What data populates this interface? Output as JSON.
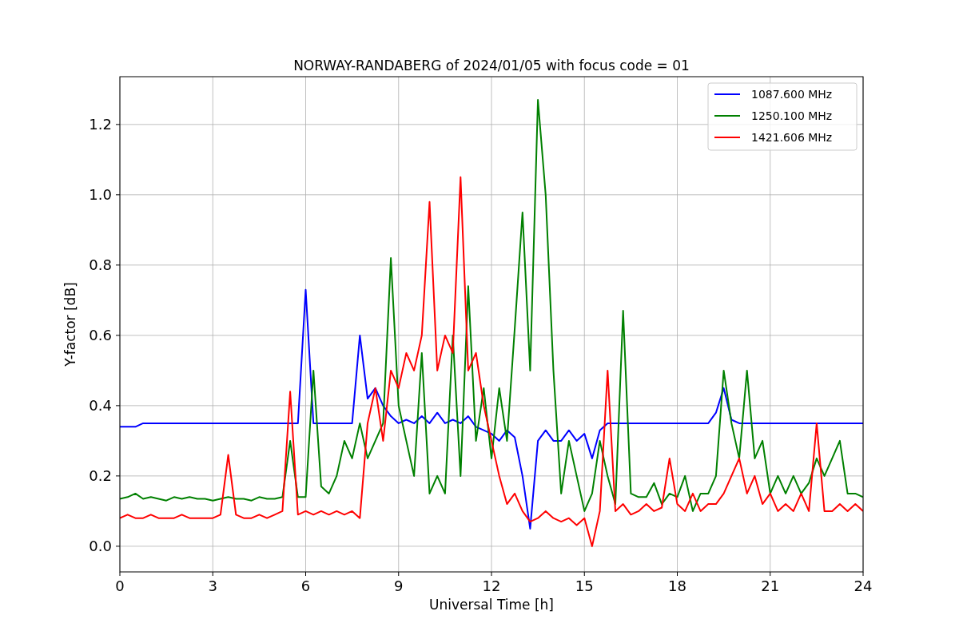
{
  "chart_data": {
    "type": "line",
    "title": "NORWAY-RANDABERG of 2024/01/05 with focus code = 01",
    "xlabel": "Universal Time [h]",
    "ylabel": "Y-factor [dB]",
    "x": [
      0,
      0.25,
      0.5,
      0.75,
      1,
      1.25,
      1.5,
      1.75,
      2,
      2.25,
      2.5,
      2.75,
      3,
      3.25,
      3.5,
      3.75,
      4,
      4.25,
      4.5,
      4.75,
      5,
      5.25,
      5.5,
      5.75,
      6,
      6.25,
      6.5,
      6.75,
      7,
      7.25,
      7.5,
      7.75,
      8,
      8.25,
      8.5,
      8.75,
      9,
      9.25,
      9.5,
      9.75,
      10,
      10.25,
      10.5,
      10.75,
      11,
      11.25,
      11.5,
      11.75,
      12,
      12.25,
      12.5,
      12.75,
      13,
      13.25,
      13.5,
      13.75,
      14,
      14.25,
      14.5,
      14.75,
      15,
      15.25,
      15.5,
      15.75,
      16,
      16.25,
      16.5,
      16.75,
      17,
      17.25,
      17.5,
      17.75,
      18,
      18.25,
      18.5,
      18.75,
      19,
      19.25,
      19.5,
      19.75,
      20,
      20.25,
      20.5,
      20.75,
      21,
      21.25,
      21.5,
      21.75,
      22,
      22.25,
      22.5,
      22.75,
      23,
      23.25,
      23.5,
      23.75,
      24
    ],
    "series": [
      {
        "name": "1087.600 MHz",
        "color": "#0000ff",
        "values": [
          0.34,
          0.34,
          0.34,
          0.35,
          0.35,
          0.35,
          0.35,
          0.35,
          0.35,
          0.35,
          0.35,
          0.35,
          0.35,
          0.35,
          0.35,
          0.35,
          0.35,
          0.35,
          0.35,
          0.35,
          0.35,
          0.35,
          0.35,
          0.35,
          0.73,
          0.35,
          0.35,
          0.35,
          0.35,
          0.35,
          0.35,
          0.6,
          0.42,
          0.45,
          0.4,
          0.37,
          0.35,
          0.36,
          0.35,
          0.37,
          0.35,
          0.38,
          0.35,
          0.36,
          0.35,
          0.37,
          0.34,
          0.33,
          0.32,
          0.3,
          0.33,
          0.31,
          0.2,
          0.05,
          0.3,
          0.33,
          0.3,
          0.3,
          0.33,
          0.3,
          0.32,
          0.25,
          0.33,
          0.35,
          0.35,
          0.35,
          0.35,
          0.35,
          0.35,
          0.35,
          0.35,
          0.35,
          0.35,
          0.35,
          0.35,
          0.35,
          0.35,
          0.38,
          0.45,
          0.36,
          0.35,
          0.35,
          0.35,
          0.35,
          0.35,
          0.35,
          0.35,
          0.35,
          0.35,
          0.35,
          0.35,
          0.35,
          0.35,
          0.35,
          0.35,
          0.35,
          0.35
        ]
      },
      {
        "name": "1250.100 MHz",
        "color": "#008000",
        "values": [
          0.135,
          0.14,
          0.15,
          0.135,
          0.14,
          0.135,
          0.13,
          0.14,
          0.135,
          0.14,
          0.135,
          0.135,
          0.13,
          0.135,
          0.14,
          0.135,
          0.135,
          0.13,
          0.14,
          0.135,
          0.135,
          0.14,
          0.3,
          0.14,
          0.14,
          0.5,
          0.17,
          0.15,
          0.2,
          0.3,
          0.25,
          0.35,
          0.25,
          0.3,
          0.35,
          0.82,
          0.4,
          0.3,
          0.2,
          0.55,
          0.15,
          0.2,
          0.15,
          0.6,
          0.2,
          0.74,
          0.3,
          0.45,
          0.25,
          0.45,
          0.3,
          0.62,
          0.95,
          0.5,
          1.27,
          1.0,
          0.5,
          0.15,
          0.3,
          0.2,
          0.1,
          0.15,
          0.3,
          0.2,
          0.12,
          0.67,
          0.15,
          0.14,
          0.14,
          0.18,
          0.12,
          0.15,
          0.14,
          0.2,
          0.1,
          0.15,
          0.15,
          0.2,
          0.5,
          0.35,
          0.25,
          0.5,
          0.25,
          0.3,
          0.15,
          0.2,
          0.15,
          0.2,
          0.15,
          0.18,
          0.25,
          0.2,
          0.25,
          0.3,
          0.15,
          0.15,
          0.14
        ]
      },
      {
        "name": "1421.606 MHz",
        "color": "#ff0000",
        "values": [
          0.08,
          0.09,
          0.08,
          0.08,
          0.09,
          0.08,
          0.08,
          0.08,
          0.09,
          0.08,
          0.08,
          0.08,
          0.08,
          0.09,
          0.26,
          0.09,
          0.08,
          0.08,
          0.09,
          0.08,
          0.09,
          0.1,
          0.44,
          0.09,
          0.1,
          0.09,
          0.1,
          0.09,
          0.1,
          0.09,
          0.1,
          0.08,
          0.35,
          0.45,
          0.3,
          0.5,
          0.45,
          0.55,
          0.5,
          0.6,
          0.98,
          0.5,
          0.6,
          0.55,
          1.05,
          0.5,
          0.55,
          0.4,
          0.3,
          0.2,
          0.12,
          0.15,
          0.1,
          0.07,
          0.08,
          0.1,
          0.08,
          0.07,
          0.08,
          0.06,
          0.08,
          0.0,
          0.1,
          0.5,
          0.1,
          0.12,
          0.09,
          0.1,
          0.12,
          0.1,
          0.11,
          0.25,
          0.12,
          0.1,
          0.15,
          0.1,
          0.12,
          0.12,
          0.15,
          0.2,
          0.25,
          0.15,
          0.2,
          0.12,
          0.15,
          0.1,
          0.12,
          0.1,
          0.15,
          0.1,
          0.35,
          0.1,
          0.1,
          0.12,
          0.1,
          0.12,
          0.1
        ]
      }
    ],
    "grid": true,
    "legend": true,
    "xlim": [
      0,
      24
    ],
    "ylim": [
      -0.073,
      1.336
    ],
    "xticks": [
      0,
      3,
      6,
      9,
      12,
      15,
      18,
      21,
      24
    ],
    "yticks": [
      {
        "value": 0,
        "label": "0.0"
      },
      {
        "value": 0.2,
        "label": "0.2"
      },
      {
        "value": 0.4,
        "label": "0.4"
      },
      {
        "value": 0.6,
        "label": "0.6"
      },
      {
        "value": 0.8,
        "label": "0.8"
      },
      {
        "value": 1.0,
        "label": "1.0"
      },
      {
        "value": 1.2,
        "label": "1.2"
      }
    ]
  }
}
